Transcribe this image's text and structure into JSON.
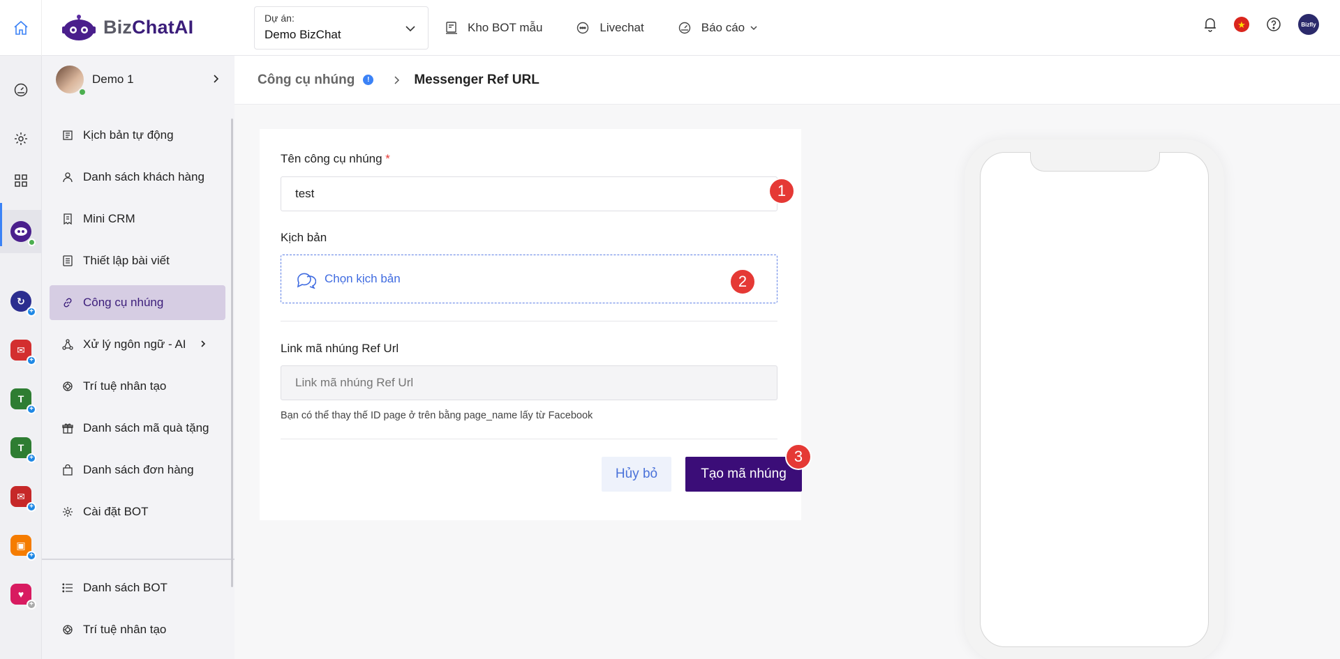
{
  "brand": {
    "part1": "Biz",
    "part2": "ChatAI"
  },
  "project": {
    "label": "Dự án:",
    "value": "Demo BizChat"
  },
  "topnav": [
    {
      "label": "Kho BOT mẫu"
    },
    {
      "label": "Livechat"
    },
    {
      "label": "Báo cáo"
    }
  ],
  "avatar_text": "Bizfly",
  "sidebar": {
    "profile_name": "Demo 1",
    "items": [
      {
        "label": "Kịch bản tự động"
      },
      {
        "label": "Danh sách khách hàng"
      },
      {
        "label": "Mini CRM"
      },
      {
        "label": "Thiết lập bài viết"
      },
      {
        "label": "Công cụ nhúng"
      },
      {
        "label": "Xử lý ngôn ngữ - AI"
      },
      {
        "label": "Trí tuệ nhân tạo"
      },
      {
        "label": "Danh sách mã quà tặng"
      },
      {
        "label": "Danh sách đơn hàng"
      },
      {
        "label": "Cài đặt BOT"
      }
    ],
    "bottom_items": [
      {
        "label": "Danh sách BOT"
      },
      {
        "label": "Trí tuệ nhân tạo"
      }
    ]
  },
  "breadcrumb": {
    "parent": "Công cụ nhúng",
    "info": "!",
    "current": "Messenger Ref URL"
  },
  "form": {
    "name_label": "Tên công cụ nhúng",
    "required_mark": "*",
    "name_value": "test",
    "script_label": "Kịch bản",
    "script_choose": "Chọn kịch bản",
    "link_label": "Link mã nhúng Ref Url",
    "link_placeholder": "Link mã nhúng Ref Url",
    "hint": "Bạn có thể thay thế ID page ở trên bằng page_name lấy từ Facebook",
    "cancel_label": "Hủy bỏ",
    "create_label": "Tạo mã nhúng"
  },
  "badges": [
    "1",
    "2",
    "3"
  ],
  "colors": {
    "accent": "#3b0d78",
    "link": "#3f6be0",
    "active_bg": "#d6cde3",
    "badge": "#e53935"
  }
}
